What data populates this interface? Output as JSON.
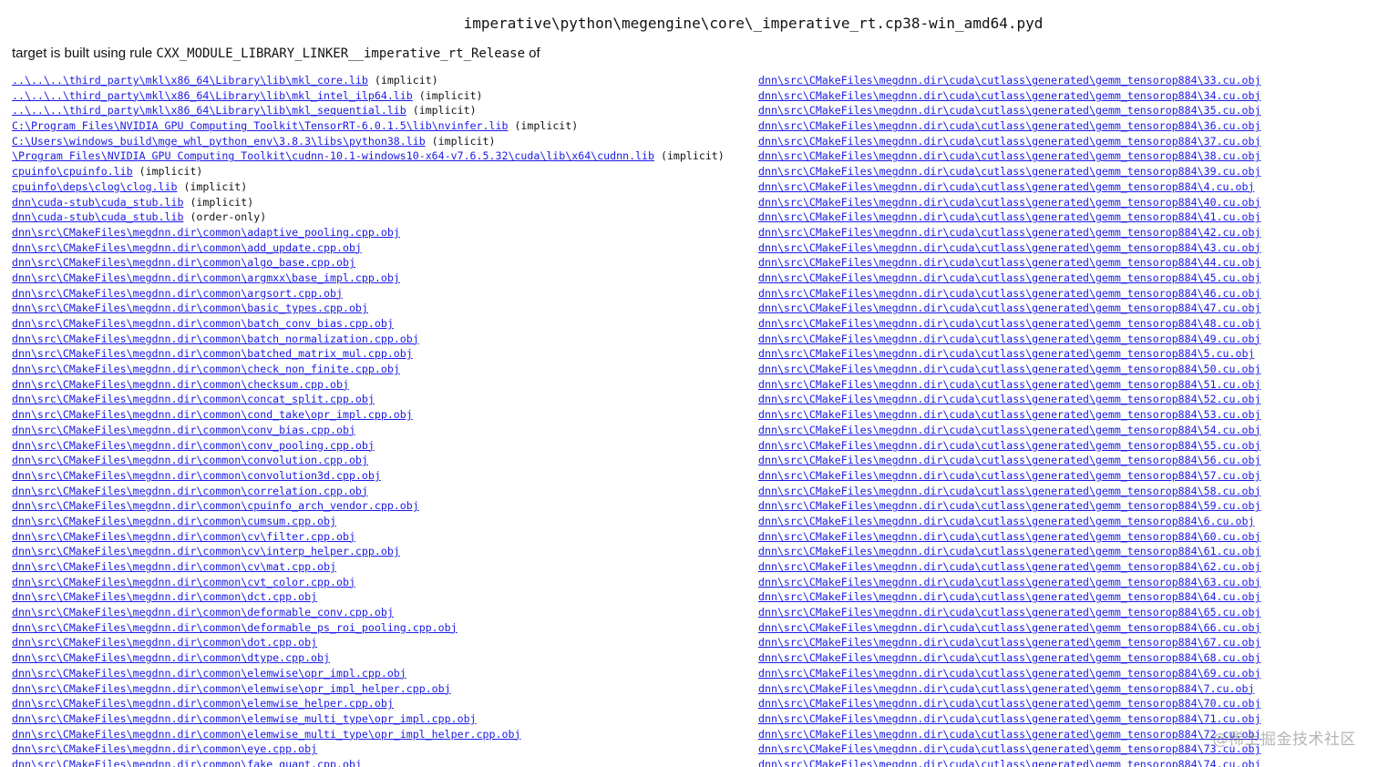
{
  "page": {
    "title": "imperative\\python\\megengine\\core\\_imperative_rt.cp38-win_amd64.pyd",
    "target_prefix": "target is built using rule ",
    "target_rule": "CXX_MODULE_LIBRARY_LINKER__imperative_rt_Release",
    "target_suffix": " of"
  },
  "left_column": [
    {
      "path": "..\\..\\..\\third_party\\mkl\\x86_64\\Library\\lib\\mkl_core.lib",
      "note": " (implicit)"
    },
    {
      "path": "..\\..\\..\\third_party\\mkl\\x86_64\\Library\\lib\\mkl_intel_ilp64.lib",
      "note": " (implicit)"
    },
    {
      "path": "..\\..\\..\\third_party\\mkl\\x86_64\\Library\\lib\\mkl_sequential.lib",
      "note": " (implicit)"
    },
    {
      "path": "C:\\Program Files\\NVIDIA GPU Computing Toolkit\\TensorRT-6.0.1.5\\lib\\nvinfer.lib",
      "note": " (implicit)"
    },
    {
      "path": "C:\\Users\\windows_build\\mge_whl_python_env\\3.8.3\\libs\\python38.lib",
      "note": " (implicit)"
    },
    {
      "path": "\\Program Files\\NVIDIA GPU Computing Toolkit\\cudnn-10.1-windows10-x64-v7.6.5.32\\cuda\\lib\\x64\\cudnn.lib",
      "note": " (implicit)"
    },
    {
      "path": "cpuinfo\\cpuinfo.lib",
      "note": " (implicit)"
    },
    {
      "path": "cpuinfo\\deps\\clog\\clog.lib",
      "note": " (implicit)"
    },
    {
      "path": "dnn\\cuda-stub\\cuda_stub.lib",
      "note": " (implicit)"
    },
    {
      "path": "dnn\\cuda-stub\\cuda_stub.lib",
      "note": " (order-only)"
    },
    {
      "path": "dnn\\src\\CMakeFiles\\megdnn.dir\\common\\adaptive_pooling.cpp.obj",
      "note": ""
    },
    {
      "path": "dnn\\src\\CMakeFiles\\megdnn.dir\\common\\add_update.cpp.obj",
      "note": ""
    },
    {
      "path": "dnn\\src\\CMakeFiles\\megdnn.dir\\common\\algo_base.cpp.obj",
      "note": ""
    },
    {
      "path": "dnn\\src\\CMakeFiles\\megdnn.dir\\common\\argmxx\\base_impl.cpp.obj",
      "note": ""
    },
    {
      "path": "dnn\\src\\CMakeFiles\\megdnn.dir\\common\\argsort.cpp.obj",
      "note": ""
    },
    {
      "path": "dnn\\src\\CMakeFiles\\megdnn.dir\\common\\basic_types.cpp.obj",
      "note": ""
    },
    {
      "path": "dnn\\src\\CMakeFiles\\megdnn.dir\\common\\batch_conv_bias.cpp.obj",
      "note": ""
    },
    {
      "path": "dnn\\src\\CMakeFiles\\megdnn.dir\\common\\batch_normalization.cpp.obj",
      "note": ""
    },
    {
      "path": "dnn\\src\\CMakeFiles\\megdnn.dir\\common\\batched_matrix_mul.cpp.obj",
      "note": ""
    },
    {
      "path": "dnn\\src\\CMakeFiles\\megdnn.dir\\common\\check_non_finite.cpp.obj",
      "note": ""
    },
    {
      "path": "dnn\\src\\CMakeFiles\\megdnn.dir\\common\\checksum.cpp.obj",
      "note": ""
    },
    {
      "path": "dnn\\src\\CMakeFiles\\megdnn.dir\\common\\concat_split.cpp.obj",
      "note": ""
    },
    {
      "path": "dnn\\src\\CMakeFiles\\megdnn.dir\\common\\cond_take\\opr_impl.cpp.obj",
      "note": ""
    },
    {
      "path": "dnn\\src\\CMakeFiles\\megdnn.dir\\common\\conv_bias.cpp.obj",
      "note": ""
    },
    {
      "path": "dnn\\src\\CMakeFiles\\megdnn.dir\\common\\conv_pooling.cpp.obj",
      "note": ""
    },
    {
      "path": "dnn\\src\\CMakeFiles\\megdnn.dir\\common\\convolution.cpp.obj",
      "note": ""
    },
    {
      "path": "dnn\\src\\CMakeFiles\\megdnn.dir\\common\\convolution3d.cpp.obj",
      "note": ""
    },
    {
      "path": "dnn\\src\\CMakeFiles\\megdnn.dir\\common\\correlation.cpp.obj",
      "note": ""
    },
    {
      "path": "dnn\\src\\CMakeFiles\\megdnn.dir\\common\\cpuinfo_arch_vendor.cpp.obj",
      "note": ""
    },
    {
      "path": "dnn\\src\\CMakeFiles\\megdnn.dir\\common\\cumsum.cpp.obj",
      "note": ""
    },
    {
      "path": "dnn\\src\\CMakeFiles\\megdnn.dir\\common\\cv\\filter.cpp.obj",
      "note": ""
    },
    {
      "path": "dnn\\src\\CMakeFiles\\megdnn.dir\\common\\cv\\interp_helper.cpp.obj",
      "note": ""
    },
    {
      "path": "dnn\\src\\CMakeFiles\\megdnn.dir\\common\\cv\\mat.cpp.obj",
      "note": ""
    },
    {
      "path": "dnn\\src\\CMakeFiles\\megdnn.dir\\common\\cvt_color.cpp.obj",
      "note": ""
    },
    {
      "path": "dnn\\src\\CMakeFiles\\megdnn.dir\\common\\dct.cpp.obj",
      "note": ""
    },
    {
      "path": "dnn\\src\\CMakeFiles\\megdnn.dir\\common\\deformable_conv.cpp.obj",
      "note": ""
    },
    {
      "path": "dnn\\src\\CMakeFiles\\megdnn.dir\\common\\deformable_ps_roi_pooling.cpp.obj",
      "note": ""
    },
    {
      "path": "dnn\\src\\CMakeFiles\\megdnn.dir\\common\\dot.cpp.obj",
      "note": ""
    },
    {
      "path": "dnn\\src\\CMakeFiles\\megdnn.dir\\common\\dtype.cpp.obj",
      "note": ""
    },
    {
      "path": "dnn\\src\\CMakeFiles\\megdnn.dir\\common\\elemwise\\opr_impl.cpp.obj",
      "note": ""
    },
    {
      "path": "dnn\\src\\CMakeFiles\\megdnn.dir\\common\\elemwise\\opr_impl_helper.cpp.obj",
      "note": ""
    },
    {
      "path": "dnn\\src\\CMakeFiles\\megdnn.dir\\common\\elemwise_helper.cpp.obj",
      "note": ""
    },
    {
      "path": "dnn\\src\\CMakeFiles\\megdnn.dir\\common\\elemwise_multi_type\\opr_impl.cpp.obj",
      "note": ""
    },
    {
      "path": "dnn\\src\\CMakeFiles\\megdnn.dir\\common\\elemwise_multi_type\\opr_impl_helper.cpp.obj",
      "note": ""
    },
    {
      "path": "dnn\\src\\CMakeFiles\\megdnn.dir\\common\\eye.cpp.obj",
      "note": ""
    },
    {
      "path": "dnn\\src\\CMakeFiles\\megdnn.dir\\common\\fake_quant.cpp.obj",
      "note": ""
    }
  ],
  "right_column": [
    {
      "path": "dnn\\src\\CMakeFiles\\megdnn.dir\\cuda\\cutlass\\generated\\gemm_tensorop884\\33.cu.obj",
      "note": ""
    },
    {
      "path": "dnn\\src\\CMakeFiles\\megdnn.dir\\cuda\\cutlass\\generated\\gemm_tensorop884\\34.cu.obj",
      "note": ""
    },
    {
      "path": "dnn\\src\\CMakeFiles\\megdnn.dir\\cuda\\cutlass\\generated\\gemm_tensorop884\\35.cu.obj",
      "note": ""
    },
    {
      "path": "dnn\\src\\CMakeFiles\\megdnn.dir\\cuda\\cutlass\\generated\\gemm_tensorop884\\36.cu.obj",
      "note": ""
    },
    {
      "path": "dnn\\src\\CMakeFiles\\megdnn.dir\\cuda\\cutlass\\generated\\gemm_tensorop884\\37.cu.obj",
      "note": ""
    },
    {
      "path": "dnn\\src\\CMakeFiles\\megdnn.dir\\cuda\\cutlass\\generated\\gemm_tensorop884\\38.cu.obj",
      "note": ""
    },
    {
      "path": "dnn\\src\\CMakeFiles\\megdnn.dir\\cuda\\cutlass\\generated\\gemm_tensorop884\\39.cu.obj",
      "note": ""
    },
    {
      "path": "dnn\\src\\CMakeFiles\\megdnn.dir\\cuda\\cutlass\\generated\\gemm_tensorop884\\4.cu.obj",
      "note": ""
    },
    {
      "path": "dnn\\src\\CMakeFiles\\megdnn.dir\\cuda\\cutlass\\generated\\gemm_tensorop884\\40.cu.obj",
      "note": ""
    },
    {
      "path": "dnn\\src\\CMakeFiles\\megdnn.dir\\cuda\\cutlass\\generated\\gemm_tensorop884\\41.cu.obj",
      "note": ""
    },
    {
      "path": "dnn\\src\\CMakeFiles\\megdnn.dir\\cuda\\cutlass\\generated\\gemm_tensorop884\\42.cu.obj",
      "note": ""
    },
    {
      "path": "dnn\\src\\CMakeFiles\\megdnn.dir\\cuda\\cutlass\\generated\\gemm_tensorop884\\43.cu.obj",
      "note": ""
    },
    {
      "path": "dnn\\src\\CMakeFiles\\megdnn.dir\\cuda\\cutlass\\generated\\gemm_tensorop884\\44.cu.obj",
      "note": ""
    },
    {
      "path": "dnn\\src\\CMakeFiles\\megdnn.dir\\cuda\\cutlass\\generated\\gemm_tensorop884\\45.cu.obj",
      "note": ""
    },
    {
      "path": "dnn\\src\\CMakeFiles\\megdnn.dir\\cuda\\cutlass\\generated\\gemm_tensorop884\\46.cu.obj",
      "note": ""
    },
    {
      "path": "dnn\\src\\CMakeFiles\\megdnn.dir\\cuda\\cutlass\\generated\\gemm_tensorop884\\47.cu.obj",
      "note": ""
    },
    {
      "path": "dnn\\src\\CMakeFiles\\megdnn.dir\\cuda\\cutlass\\generated\\gemm_tensorop884\\48.cu.obj",
      "note": ""
    },
    {
      "path": "dnn\\src\\CMakeFiles\\megdnn.dir\\cuda\\cutlass\\generated\\gemm_tensorop884\\49.cu.obj",
      "note": ""
    },
    {
      "path": "dnn\\src\\CMakeFiles\\megdnn.dir\\cuda\\cutlass\\generated\\gemm_tensorop884\\5.cu.obj",
      "note": ""
    },
    {
      "path": "dnn\\src\\CMakeFiles\\megdnn.dir\\cuda\\cutlass\\generated\\gemm_tensorop884\\50.cu.obj",
      "note": ""
    },
    {
      "path": "dnn\\src\\CMakeFiles\\megdnn.dir\\cuda\\cutlass\\generated\\gemm_tensorop884\\51.cu.obj",
      "note": ""
    },
    {
      "path": "dnn\\src\\CMakeFiles\\megdnn.dir\\cuda\\cutlass\\generated\\gemm_tensorop884\\52.cu.obj",
      "note": ""
    },
    {
      "path": "dnn\\src\\CMakeFiles\\megdnn.dir\\cuda\\cutlass\\generated\\gemm_tensorop884\\53.cu.obj",
      "note": ""
    },
    {
      "path": "dnn\\src\\CMakeFiles\\megdnn.dir\\cuda\\cutlass\\generated\\gemm_tensorop884\\54.cu.obj",
      "note": ""
    },
    {
      "path": "dnn\\src\\CMakeFiles\\megdnn.dir\\cuda\\cutlass\\generated\\gemm_tensorop884\\55.cu.obj",
      "note": ""
    },
    {
      "path": "dnn\\src\\CMakeFiles\\megdnn.dir\\cuda\\cutlass\\generated\\gemm_tensorop884\\56.cu.obj",
      "note": ""
    },
    {
      "path": "dnn\\src\\CMakeFiles\\megdnn.dir\\cuda\\cutlass\\generated\\gemm_tensorop884\\57.cu.obj",
      "note": ""
    },
    {
      "path": "dnn\\src\\CMakeFiles\\megdnn.dir\\cuda\\cutlass\\generated\\gemm_tensorop884\\58.cu.obj",
      "note": ""
    },
    {
      "path": "dnn\\src\\CMakeFiles\\megdnn.dir\\cuda\\cutlass\\generated\\gemm_tensorop884\\59.cu.obj",
      "note": ""
    },
    {
      "path": "dnn\\src\\CMakeFiles\\megdnn.dir\\cuda\\cutlass\\generated\\gemm_tensorop884\\6.cu.obj",
      "note": ""
    },
    {
      "path": "dnn\\src\\CMakeFiles\\megdnn.dir\\cuda\\cutlass\\generated\\gemm_tensorop884\\60.cu.obj",
      "note": ""
    },
    {
      "path": "dnn\\src\\CMakeFiles\\megdnn.dir\\cuda\\cutlass\\generated\\gemm_tensorop884\\61.cu.obj",
      "note": ""
    },
    {
      "path": "dnn\\src\\CMakeFiles\\megdnn.dir\\cuda\\cutlass\\generated\\gemm_tensorop884\\62.cu.obj",
      "note": ""
    },
    {
      "path": "dnn\\src\\CMakeFiles\\megdnn.dir\\cuda\\cutlass\\generated\\gemm_tensorop884\\63.cu.obj",
      "note": ""
    },
    {
      "path": "dnn\\src\\CMakeFiles\\megdnn.dir\\cuda\\cutlass\\generated\\gemm_tensorop884\\64.cu.obj",
      "note": ""
    },
    {
      "path": "dnn\\src\\CMakeFiles\\megdnn.dir\\cuda\\cutlass\\generated\\gemm_tensorop884\\65.cu.obj",
      "note": ""
    },
    {
      "path": "dnn\\src\\CMakeFiles\\megdnn.dir\\cuda\\cutlass\\generated\\gemm_tensorop884\\66.cu.obj",
      "note": ""
    },
    {
      "path": "dnn\\src\\CMakeFiles\\megdnn.dir\\cuda\\cutlass\\generated\\gemm_tensorop884\\67.cu.obj",
      "note": ""
    },
    {
      "path": "dnn\\src\\CMakeFiles\\megdnn.dir\\cuda\\cutlass\\generated\\gemm_tensorop884\\68.cu.obj",
      "note": ""
    },
    {
      "path": "dnn\\src\\CMakeFiles\\megdnn.dir\\cuda\\cutlass\\generated\\gemm_tensorop884\\69.cu.obj",
      "note": ""
    },
    {
      "path": "dnn\\src\\CMakeFiles\\megdnn.dir\\cuda\\cutlass\\generated\\gemm_tensorop884\\7.cu.obj",
      "note": ""
    },
    {
      "path": "dnn\\src\\CMakeFiles\\megdnn.dir\\cuda\\cutlass\\generated\\gemm_tensorop884\\70.cu.obj",
      "note": ""
    },
    {
      "path": "dnn\\src\\CMakeFiles\\megdnn.dir\\cuda\\cutlass\\generated\\gemm_tensorop884\\71.cu.obj",
      "note": ""
    },
    {
      "path": "dnn\\src\\CMakeFiles\\megdnn.dir\\cuda\\cutlass\\generated\\gemm_tensorop884\\72.cu.obj",
      "note": ""
    },
    {
      "path": "dnn\\src\\CMakeFiles\\megdnn.dir\\cuda\\cutlass\\generated\\gemm_tensorop884\\73.cu.obj",
      "note": ""
    },
    {
      "path": "dnn\\src\\CMakeFiles\\megdnn.dir\\cuda\\cutlass\\generated\\gemm_tensorop884\\74.cu.obj",
      "note": ""
    }
  ],
  "watermark": "@稀土掘金技术社区",
  "colors": {
    "link": "#1a1ae6",
    "text": "#111111",
    "background": "#ffffff"
  }
}
